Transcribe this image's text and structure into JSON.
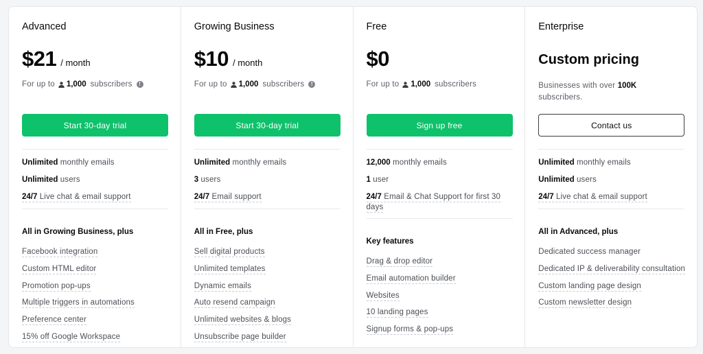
{
  "colors": {
    "accent_green": "#0ec16b",
    "page_bg": "#f4f5f7",
    "card_bg": "#ffffff",
    "text_dark": "#09090b",
    "text_muted": "#5b5e66"
  },
  "plans": [
    {
      "name": "Advanced",
      "price": "$21",
      "period": "/ month",
      "sub_prefix": "For up to",
      "sub_icon": "user-icon",
      "sub_count": "1,000",
      "sub_suffix": "subscribers",
      "info_icon": "info-icon",
      "cta_label": "Start 30-day trial",
      "limits": [
        {
          "bold": "Unlimited",
          "text": "monthly emails"
        },
        {
          "bold": "Unlimited",
          "text": "users"
        },
        {
          "bold": "24/7",
          "text": "Live chat & email support"
        }
      ],
      "features_heading": "All in Growing Business, plus",
      "features": [
        "Facebook integration",
        "Custom HTML editor",
        "Promotion pop-ups",
        "Multiple triggers in automations",
        "Preference center",
        "15% off Google Workspace"
      ]
    },
    {
      "name": "Growing Business",
      "price": "$10",
      "period": "/ month",
      "sub_prefix": "For up to",
      "sub_icon": "user-icon",
      "sub_count": "1,000",
      "sub_suffix": "subscribers",
      "info_icon": "info-icon",
      "cta_label": "Start 30-day trial",
      "limits": [
        {
          "bold": "Unlimited",
          "text": "monthly emails"
        },
        {
          "bold": "3",
          "text": "users"
        },
        {
          "bold": "24/7",
          "text": "Email support"
        }
      ],
      "features_heading": "All in Free, plus",
      "features": [
        "Sell digital products",
        "Unlimited templates",
        "Dynamic emails",
        "Auto resend campaign",
        "Unlimited websites & blogs",
        "Unsubscribe page builder"
      ]
    },
    {
      "name": "Free",
      "price": "$0",
      "sub_prefix": "For up to",
      "sub_icon": "user-icon",
      "sub_count": "1,000",
      "sub_suffix": "subscribers",
      "cta_label": "Sign up free",
      "limits": [
        {
          "bold": "12,000",
          "text": "monthly emails"
        },
        {
          "bold": "1",
          "text": "user"
        },
        {
          "bold": "24/7",
          "text": "Email & Chat Support for first 30 days"
        }
      ],
      "features_heading": "Key features",
      "features": [
        "Drag & drop editor",
        "Email automation builder",
        "Websites",
        "10 landing pages",
        "Signup forms & pop-ups"
      ]
    },
    {
      "name": "Enterprise",
      "price": "Custom pricing",
      "desc_prefix": "Businesses with over",
      "desc_bold": "100K",
      "desc_suffix": "subscribers.",
      "cta_label": "Contact us",
      "limits": [
        {
          "bold": "Unlimited",
          "text": "monthly emails"
        },
        {
          "bold": "Unlimited",
          "text": "users"
        },
        {
          "bold": "24/7",
          "text": "Live chat & email support"
        }
      ],
      "features_heading": "All in Advanced, plus",
      "features": [
        "Dedicated success manager",
        "Dedicated IP & deliverability consultation",
        "Custom landing page design",
        "Custom newsletter design"
      ]
    }
  ]
}
